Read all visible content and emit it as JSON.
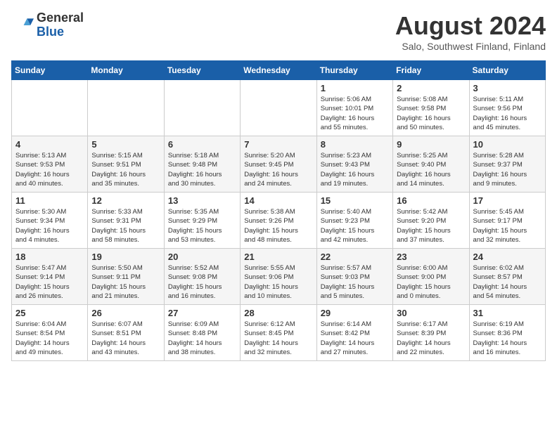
{
  "header": {
    "logo_general": "General",
    "logo_blue": "Blue",
    "month_title": "August 2024",
    "location": "Salo, Southwest Finland, Finland"
  },
  "weekdays": [
    "Sunday",
    "Monday",
    "Tuesday",
    "Wednesday",
    "Thursday",
    "Friday",
    "Saturday"
  ],
  "weeks": [
    [
      {
        "day": "",
        "info": ""
      },
      {
        "day": "",
        "info": ""
      },
      {
        "day": "",
        "info": ""
      },
      {
        "day": "",
        "info": ""
      },
      {
        "day": "1",
        "info": "Sunrise: 5:06 AM\nSunset: 10:01 PM\nDaylight: 16 hours\nand 55 minutes."
      },
      {
        "day": "2",
        "info": "Sunrise: 5:08 AM\nSunset: 9:58 PM\nDaylight: 16 hours\nand 50 minutes."
      },
      {
        "day": "3",
        "info": "Sunrise: 5:11 AM\nSunset: 9:56 PM\nDaylight: 16 hours\nand 45 minutes."
      }
    ],
    [
      {
        "day": "4",
        "info": "Sunrise: 5:13 AM\nSunset: 9:53 PM\nDaylight: 16 hours\nand 40 minutes."
      },
      {
        "day": "5",
        "info": "Sunrise: 5:15 AM\nSunset: 9:51 PM\nDaylight: 16 hours\nand 35 minutes."
      },
      {
        "day": "6",
        "info": "Sunrise: 5:18 AM\nSunset: 9:48 PM\nDaylight: 16 hours\nand 30 minutes."
      },
      {
        "day": "7",
        "info": "Sunrise: 5:20 AM\nSunset: 9:45 PM\nDaylight: 16 hours\nand 24 minutes."
      },
      {
        "day": "8",
        "info": "Sunrise: 5:23 AM\nSunset: 9:43 PM\nDaylight: 16 hours\nand 19 minutes."
      },
      {
        "day": "9",
        "info": "Sunrise: 5:25 AM\nSunset: 9:40 PM\nDaylight: 16 hours\nand 14 minutes."
      },
      {
        "day": "10",
        "info": "Sunrise: 5:28 AM\nSunset: 9:37 PM\nDaylight: 16 hours\nand 9 minutes."
      }
    ],
    [
      {
        "day": "11",
        "info": "Sunrise: 5:30 AM\nSunset: 9:34 PM\nDaylight: 16 hours\nand 4 minutes."
      },
      {
        "day": "12",
        "info": "Sunrise: 5:33 AM\nSunset: 9:31 PM\nDaylight: 15 hours\nand 58 minutes."
      },
      {
        "day": "13",
        "info": "Sunrise: 5:35 AM\nSunset: 9:29 PM\nDaylight: 15 hours\nand 53 minutes."
      },
      {
        "day": "14",
        "info": "Sunrise: 5:38 AM\nSunset: 9:26 PM\nDaylight: 15 hours\nand 48 minutes."
      },
      {
        "day": "15",
        "info": "Sunrise: 5:40 AM\nSunset: 9:23 PM\nDaylight: 15 hours\nand 42 minutes."
      },
      {
        "day": "16",
        "info": "Sunrise: 5:42 AM\nSunset: 9:20 PM\nDaylight: 15 hours\nand 37 minutes."
      },
      {
        "day": "17",
        "info": "Sunrise: 5:45 AM\nSunset: 9:17 PM\nDaylight: 15 hours\nand 32 minutes."
      }
    ],
    [
      {
        "day": "18",
        "info": "Sunrise: 5:47 AM\nSunset: 9:14 PM\nDaylight: 15 hours\nand 26 minutes."
      },
      {
        "day": "19",
        "info": "Sunrise: 5:50 AM\nSunset: 9:11 PM\nDaylight: 15 hours\nand 21 minutes."
      },
      {
        "day": "20",
        "info": "Sunrise: 5:52 AM\nSunset: 9:08 PM\nDaylight: 15 hours\nand 16 minutes."
      },
      {
        "day": "21",
        "info": "Sunrise: 5:55 AM\nSunset: 9:06 PM\nDaylight: 15 hours\nand 10 minutes."
      },
      {
        "day": "22",
        "info": "Sunrise: 5:57 AM\nSunset: 9:03 PM\nDaylight: 15 hours\nand 5 minutes."
      },
      {
        "day": "23",
        "info": "Sunrise: 6:00 AM\nSunset: 9:00 PM\nDaylight: 15 hours\nand 0 minutes."
      },
      {
        "day": "24",
        "info": "Sunrise: 6:02 AM\nSunset: 8:57 PM\nDaylight: 14 hours\nand 54 minutes."
      }
    ],
    [
      {
        "day": "25",
        "info": "Sunrise: 6:04 AM\nSunset: 8:54 PM\nDaylight: 14 hours\nand 49 minutes."
      },
      {
        "day": "26",
        "info": "Sunrise: 6:07 AM\nSunset: 8:51 PM\nDaylight: 14 hours\nand 43 minutes."
      },
      {
        "day": "27",
        "info": "Sunrise: 6:09 AM\nSunset: 8:48 PM\nDaylight: 14 hours\nand 38 minutes."
      },
      {
        "day": "28",
        "info": "Sunrise: 6:12 AM\nSunset: 8:45 PM\nDaylight: 14 hours\nand 32 minutes."
      },
      {
        "day": "29",
        "info": "Sunrise: 6:14 AM\nSunset: 8:42 PM\nDaylight: 14 hours\nand 27 minutes."
      },
      {
        "day": "30",
        "info": "Sunrise: 6:17 AM\nSunset: 8:39 PM\nDaylight: 14 hours\nand 22 minutes."
      },
      {
        "day": "31",
        "info": "Sunrise: 6:19 AM\nSunset: 8:36 PM\nDaylight: 14 hours\nand 16 minutes."
      }
    ]
  ]
}
